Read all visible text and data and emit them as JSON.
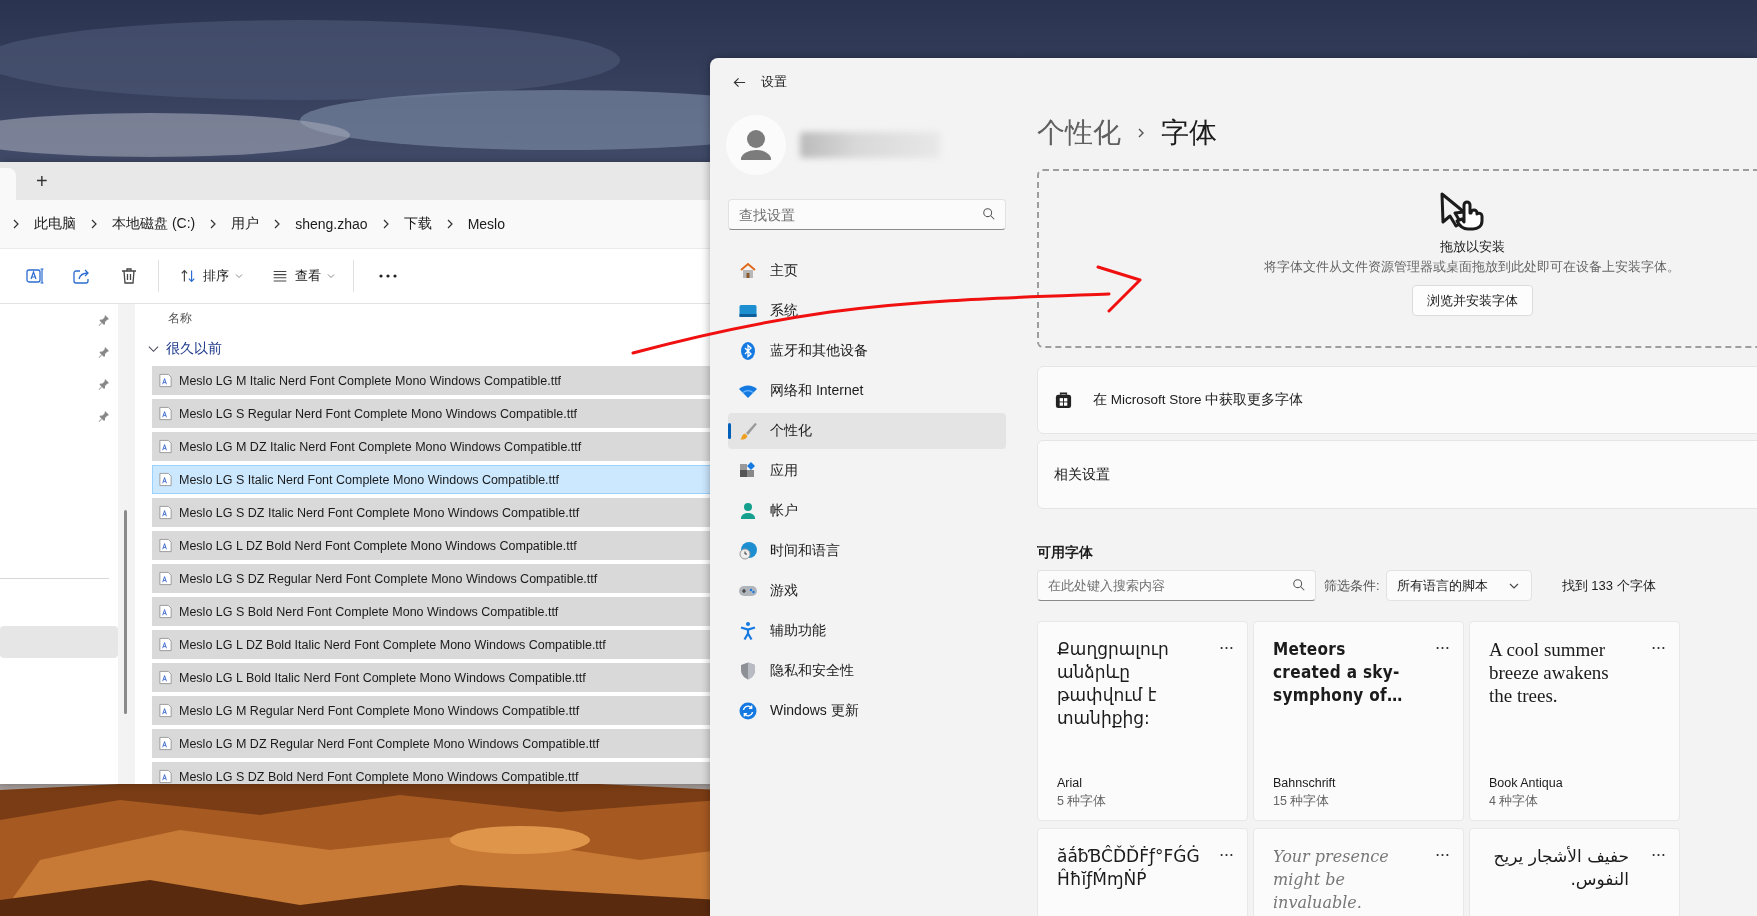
{
  "explorer": {
    "new_tab": "+",
    "breadcrumb": [
      "此电脑",
      "本地磁盘 (C:)",
      "用户",
      "sheng.zhao",
      "下载",
      "Meslo"
    ],
    "toolbar": [
      {
        "kind": "rename"
      },
      {
        "kind": "share"
      },
      {
        "kind": "delete"
      },
      {
        "kind": "sort",
        "label": "排序"
      },
      {
        "kind": "view",
        "label": "查看"
      },
      {
        "kind": "more"
      }
    ],
    "nav_sections": [
      {
        "items": [
          {
            "pinned": true,
            "selected": false
          },
          {
            "pinned": true,
            "selected": false
          },
          {
            "pinned": true,
            "selected": false
          },
          {
            "pinned": true,
            "selected": false
          }
        ]
      },
      {
        "items": [
          {
            "pinned": false,
            "selected": true
          }
        ]
      }
    ],
    "column_header": "名称",
    "group": {
      "label": "很久以前",
      "expanded": true
    },
    "files": [
      {
        "name": "Meslo LG M Italic Nerd Font Complete Mono Windows Compatible.ttf",
        "selected": true,
        "focused": false
      },
      {
        "name": "Meslo LG S Regular Nerd Font Complete Mono Windows Compatible.ttf",
        "selected": true,
        "focused": false
      },
      {
        "name": "Meslo LG M DZ Italic Nerd Font Complete Mono Windows Compatible.ttf",
        "selected": true,
        "focused": false
      },
      {
        "name": "Meslo LG S Italic Nerd Font Complete Mono Windows Compatible.ttf",
        "selected": true,
        "focused": true
      },
      {
        "name": "Meslo LG S DZ Italic Nerd Font Complete Mono Windows Compatible.ttf",
        "selected": true,
        "focused": false
      },
      {
        "name": "Meslo LG L DZ Bold Nerd Font Complete Mono Windows Compatible.ttf",
        "selected": true,
        "focused": false
      },
      {
        "name": "Meslo LG S DZ Regular Nerd Font Complete Mono Windows Compatible.ttf",
        "selected": true,
        "focused": false
      },
      {
        "name": "Meslo LG S Bold Nerd Font Complete Mono Windows Compatible.ttf",
        "selected": true,
        "focused": false
      },
      {
        "name": "Meslo LG L DZ Bold Italic Nerd Font Complete Mono Windows Compatible.ttf",
        "selected": true,
        "focused": false
      },
      {
        "name": "Meslo LG L Bold Italic Nerd Font Complete Mono Windows Compatible.ttf",
        "selected": true,
        "focused": false
      },
      {
        "name": "Meslo LG M Regular Nerd Font Complete Mono Windows Compatible.ttf",
        "selected": true,
        "focused": false
      },
      {
        "name": "Meslo LG M DZ Regular Nerd Font Complete Mono Windows Compatible.ttf",
        "selected": true,
        "focused": false
      },
      {
        "name": "Meslo LG S DZ Bold Nerd Font Complete Mono Windows Compatible.ttf",
        "selected": true,
        "focused": false
      }
    ]
  },
  "settings": {
    "title": "设置",
    "search_placeholder": "查找设置",
    "nav": [
      {
        "label": "主页",
        "selected": false
      },
      {
        "label": "系统",
        "selected": false
      },
      {
        "label": "蓝牙和其他设备",
        "selected": false
      },
      {
        "label": "网络和 Internet",
        "selected": false
      },
      {
        "label": "个性化",
        "selected": true
      },
      {
        "label": "应用",
        "selected": false
      },
      {
        "label": "帐户",
        "selected": false
      },
      {
        "label": "时间和语言",
        "selected": false
      },
      {
        "label": "游戏",
        "selected": false
      },
      {
        "label": "辅助功能",
        "selected": false
      },
      {
        "label": "隐私和安全性",
        "selected": false
      },
      {
        "label": "Windows 更新",
        "selected": false
      }
    ],
    "breadcrumb": {
      "parent": "个性化",
      "current": "字体"
    },
    "drop_zone": {
      "title": "拖放以安装",
      "description": "将字体文件从文件资源管理器或桌面拖放到此处即可在设备上安装字体。",
      "button": "浏览并安装字体"
    },
    "store_link": "在 Microsoft Store 中获取更多字体",
    "related": "相关设置",
    "fonts": {
      "heading": "可用字体",
      "search_placeholder": "在此处键入搜索内容",
      "filter_label": "筛选条件:",
      "filter_value": "所有语言的脚本",
      "count": "找到 133 个字体",
      "cards": [
        {
          "sample": "Քաղցրալուր անձրևը թափվում է տանիքից:",
          "kind": "sans",
          "name": "Arial",
          "faces": "5 种字体"
        },
        {
          "sample": "Meteors created a sky-symphony of…",
          "kind": "condensed",
          "name": "Bahnschrift",
          "faces": "15 种字体"
        },
        {
          "sample": "A cool summer breeze awakens the trees.",
          "kind": "serif",
          "name": "Book Antiqua",
          "faces": "4 种字体"
        },
        {
          "sample": "ăắƀƁĈĎĎḞƒ°FǴĠ ĤħĭƒḾɱṄṔ",
          "kind": "sans"
        },
        {
          "sample": "Your presence might be invaluable.",
          "kind": "script"
        },
        {
          "sample": "حفيف الأشجار يريح النفوس.",
          "kind": "arabic"
        }
      ]
    }
  }
}
